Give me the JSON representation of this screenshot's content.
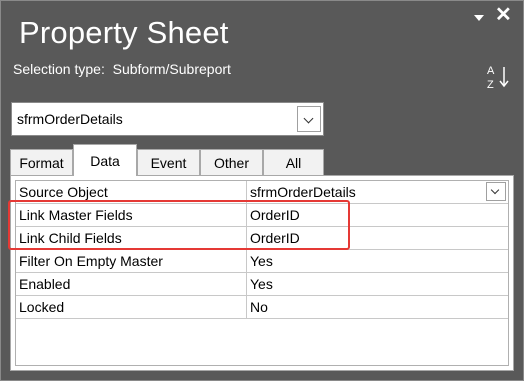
{
  "header": {
    "title": "Property Sheet",
    "selection_label": "Selection type:",
    "selection_value": "Subform/Subreport",
    "dropdown_icon": "triangle-down-icon",
    "close_icon": "close-x-icon",
    "sort_icon": "sort-az-icon"
  },
  "object_combo": {
    "value": "sfrmOrderDetails"
  },
  "tabs": [
    {
      "label": "Format",
      "active": false
    },
    {
      "label": "Data",
      "active": true
    },
    {
      "label": "Event",
      "active": false
    },
    {
      "label": "Other",
      "active": false
    },
    {
      "label": "All",
      "active": false
    }
  ],
  "properties": [
    {
      "name": "Source Object",
      "value": "sfrmOrderDetails",
      "has_dropdown": true
    },
    {
      "name": "Link Master Fields",
      "value": "OrderID",
      "has_dropdown": false
    },
    {
      "name": "Link Child Fields",
      "value": "OrderID",
      "has_dropdown": false
    },
    {
      "name": "Filter On Empty Master",
      "value": "Yes",
      "has_dropdown": false
    },
    {
      "name": "Enabled",
      "value": "Yes",
      "has_dropdown": false
    },
    {
      "name": "Locked",
      "value": "No",
      "has_dropdown": false
    }
  ],
  "colors": {
    "background": "#595959",
    "highlight": "#e53935"
  }
}
